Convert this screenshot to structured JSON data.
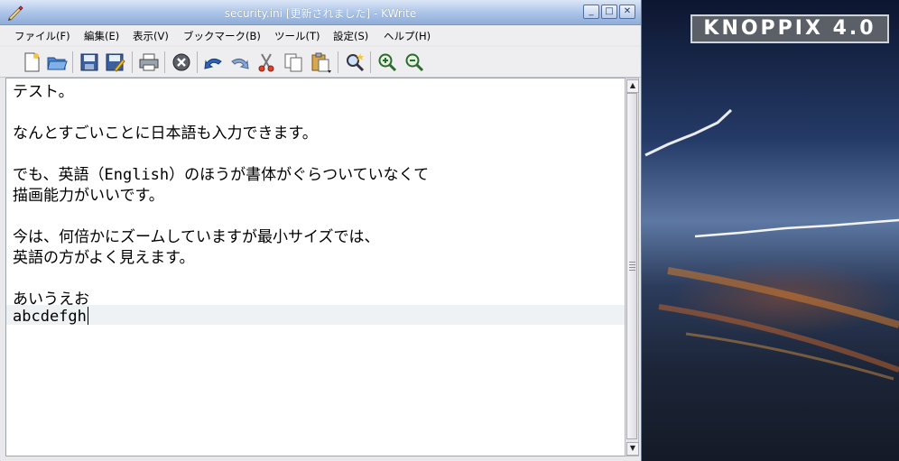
{
  "window": {
    "title": "security.ini [更新されました] - KWrite",
    "controls": {
      "minimize": "_",
      "maximize": "□",
      "close": "✕"
    }
  },
  "menu": [
    "ファイル(F)",
    "編集(E)",
    "表示(V)",
    "ブックマーク(B)",
    "ツール(T)",
    "設定(S)",
    "ヘルプ(H)"
  ],
  "toolbar": {
    "icons": [
      "new-file-icon",
      "open-folder-icon",
      "save-icon",
      "save-as-icon",
      "print-icon",
      "close-doc-icon",
      "undo-icon",
      "redo-icon",
      "cut-icon",
      "copy-icon",
      "paste-icon",
      "find-icon",
      "zoom-in-icon",
      "zoom-out-icon"
    ]
  },
  "editor": {
    "lines": [
      "テスト。",
      "",
      "なんとすごいことに日本語も入力できます。",
      "",
      "でも、英語（English）のほうが書体がぐらついていなくて",
      "描画能力がいいです。",
      "",
      "今は、何倍かにズームしていますが最小サイズでは、",
      "英語の方がよく見えます。",
      "",
      "あいうえお",
      "abcdefgh"
    ]
  },
  "desktop": {
    "logo_text": "KNOPPIX 4.0"
  },
  "colors": {
    "titlebar": "#aac2e6",
    "current_line": "#eef2f5",
    "desktop_sky": "#243a66"
  }
}
